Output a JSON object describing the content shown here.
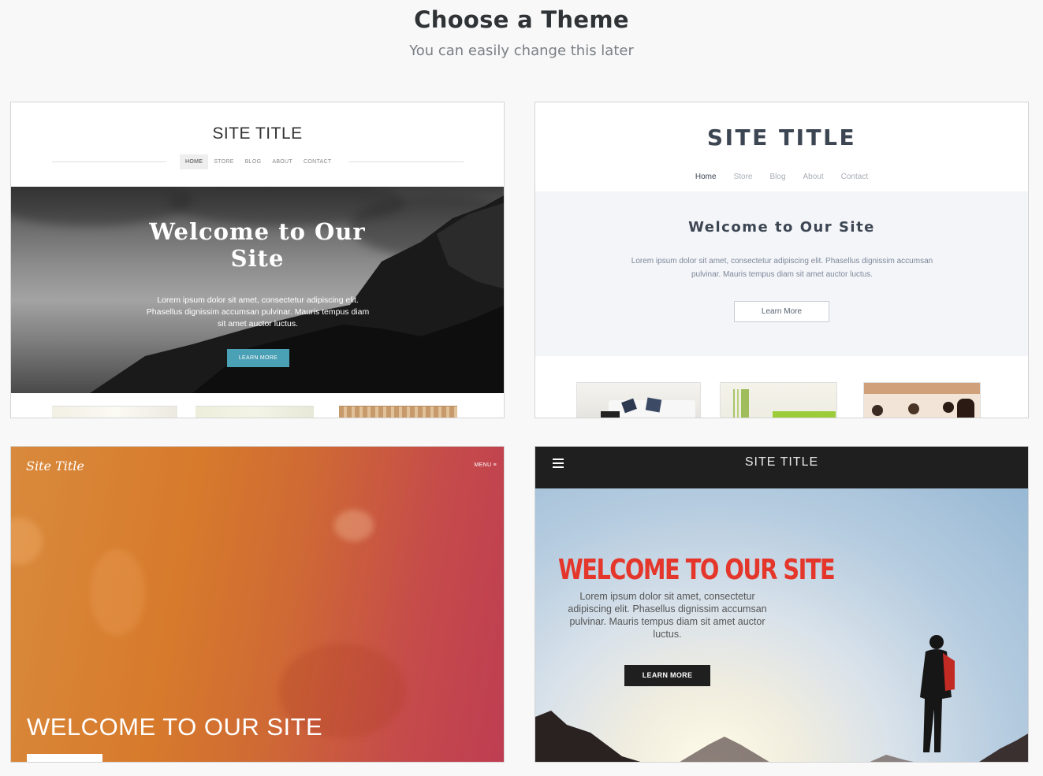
{
  "header": {
    "title": "Choose a Theme",
    "subtitle": "You can easily change this later"
  },
  "themes": [
    {
      "site_title": "SITE TITLE",
      "nav": [
        "HOME",
        "STORE",
        "BLOG",
        "ABOUT",
        "CONTACT"
      ],
      "active_nav": "HOME",
      "hero_title_line1": "Welcome to Our",
      "hero_title_line2": "Site",
      "hero_text": "Lorem ipsum dolor sit amet, consectetur adipiscing elit. Phasellus dignissim accumsan pulvinar. Mauris tempus diam sit amet auctor luctus.",
      "button": "LEARN MORE",
      "accent": "#4aa0b4"
    },
    {
      "site_title": "SITE TITLE",
      "nav": [
        "Home",
        "Store",
        "Blog",
        "About",
        "Contact"
      ],
      "active_nav": "Home",
      "hero_title": "Welcome to Our Site",
      "hero_text": "Lorem ipsum dolor sit amet, consectetur adipiscing elit. Phasellus dignissim accumsan pulvinar. Mauris tempus diam sit amet auctor luctus.",
      "button": "Learn More"
    },
    {
      "site_title": "Site Title",
      "menu": "MENU ≡",
      "hero_title": "WELCOME TO OUR SITE"
    },
    {
      "site_title": "SITE TITLE",
      "menu_icon": "hamburger-icon",
      "hero_title": "WELCOME TO OUR SITE",
      "hero_text": "Lorem ipsum dolor sit amet, consectetur adipiscing elit. Phasellus dignissim accumsan pulvinar. Mauris tempus diam sit amet auctor luctus.",
      "button": "LEARN MORE",
      "accent": "#e4362a"
    }
  ]
}
